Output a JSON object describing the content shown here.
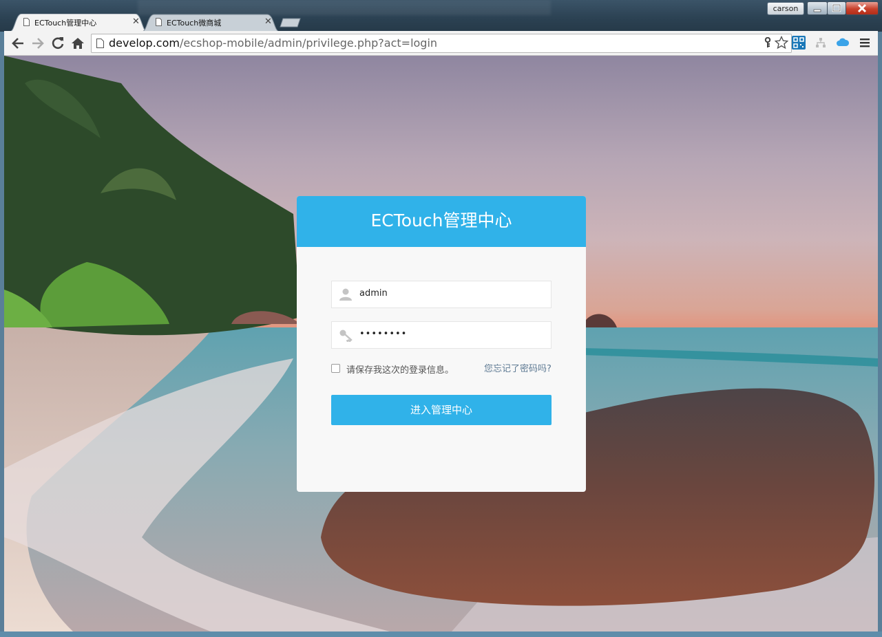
{
  "browser": {
    "tabs": [
      {
        "label": "ECTouch管理中心",
        "active": true
      },
      {
        "label": "ECTouch微商城",
        "active": false
      }
    ],
    "user": "carson",
    "url_host": "develop.com",
    "url_path": "/ecshop-mobile/admin/privilege.php?act=login",
    "icons": [
      "back-icon",
      "forward-icon",
      "reload-icon",
      "home-icon",
      "page-icon",
      "key-icon",
      "star-icon",
      "qr-code-icon",
      "sitemap-icon",
      "cloud-icon",
      "menu-icon"
    ]
  },
  "login": {
    "title": "ECTouch管理中心",
    "username": "admin",
    "password_masked": "••••••••",
    "remember_label": "请保存我这次的登录信息。",
    "remember_checked": false,
    "forgot_link": "您忘记了密码吗?",
    "submit_label": "进入管理中心"
  },
  "colors": {
    "accent": "#30b2e9",
    "panel_bg": "#f8f8f8"
  }
}
